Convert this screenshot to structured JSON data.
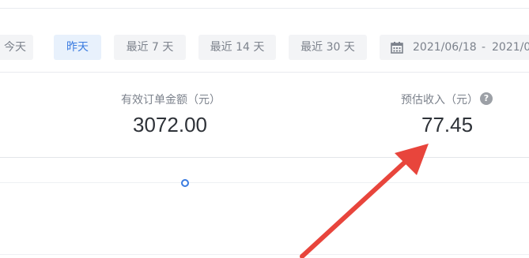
{
  "date_filter": {
    "buttons": [
      {
        "label": "今天",
        "active": false
      },
      {
        "label": "昨天",
        "active": true
      },
      {
        "label": "最近 7 天",
        "active": false
      },
      {
        "label": "最近 14 天",
        "active": false
      },
      {
        "label": "最近 30 天",
        "active": false
      }
    ],
    "range": {
      "start": "2021/06/18",
      "separator": "-",
      "end": "2021/0"
    },
    "accent_color": "#3a7be0"
  },
  "metrics": {
    "valid_order_amount": {
      "label": "有效订单金额（元）",
      "value": "3072.00"
    },
    "estimated_income": {
      "label": "预估收入（元）",
      "value": "77.45",
      "help_icon": "question-mark-icon",
      "help_symbol": "?"
    }
  },
  "annotation": {
    "arrow_color": "#e8453c"
  }
}
